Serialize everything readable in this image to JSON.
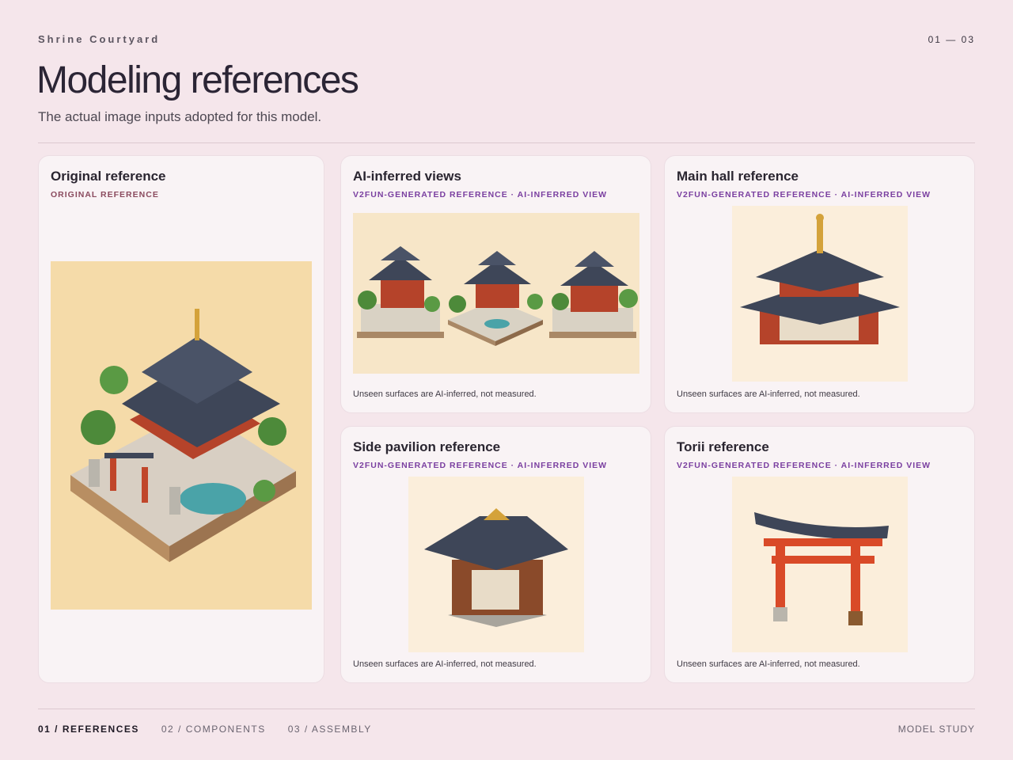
{
  "header": {
    "eyebrow": "Shrine Courtyard",
    "pager": "01 — 03",
    "title": "Modeling references",
    "subtitle": "The actual image inputs adopted for this model."
  },
  "cards": [
    {
      "title": "Original reference",
      "tag": "ORIGINAL REFERENCE",
      "note": ""
    },
    {
      "title": "AI-inferred views",
      "tag": "V2FUN-GENERATED REFERENCE · AI-INFERRED VIEW",
      "note": "Unseen surfaces are AI-inferred, not measured."
    },
    {
      "title": "Main hall reference",
      "tag": "V2FUN-GENERATED REFERENCE · AI-INFERRED VIEW",
      "note": "Unseen surfaces are AI-inferred, not measured."
    },
    {
      "title": "Side pavilion reference",
      "tag": "V2FUN-GENERATED REFERENCE · AI-INFERRED VIEW",
      "note": "Unseen surfaces are AI-inferred, not measured."
    },
    {
      "title": "Torii reference",
      "tag": "V2FUN-GENERATED REFERENCE · AI-INFERRED VIEW",
      "note": "Unseen surfaces are AI-inferred, not measured."
    }
  ],
  "nav": {
    "items": [
      "01 / REFERENCES",
      "02 / COMPONENTS",
      "03 / ASSEMBLY"
    ],
    "active_index": 0,
    "brand": "MODEL STUDY"
  },
  "colors": {
    "background": "#f5e6eb",
    "accent": "#7a3fa0",
    "roof": "#3e4658",
    "timber": "#c0462a"
  }
}
